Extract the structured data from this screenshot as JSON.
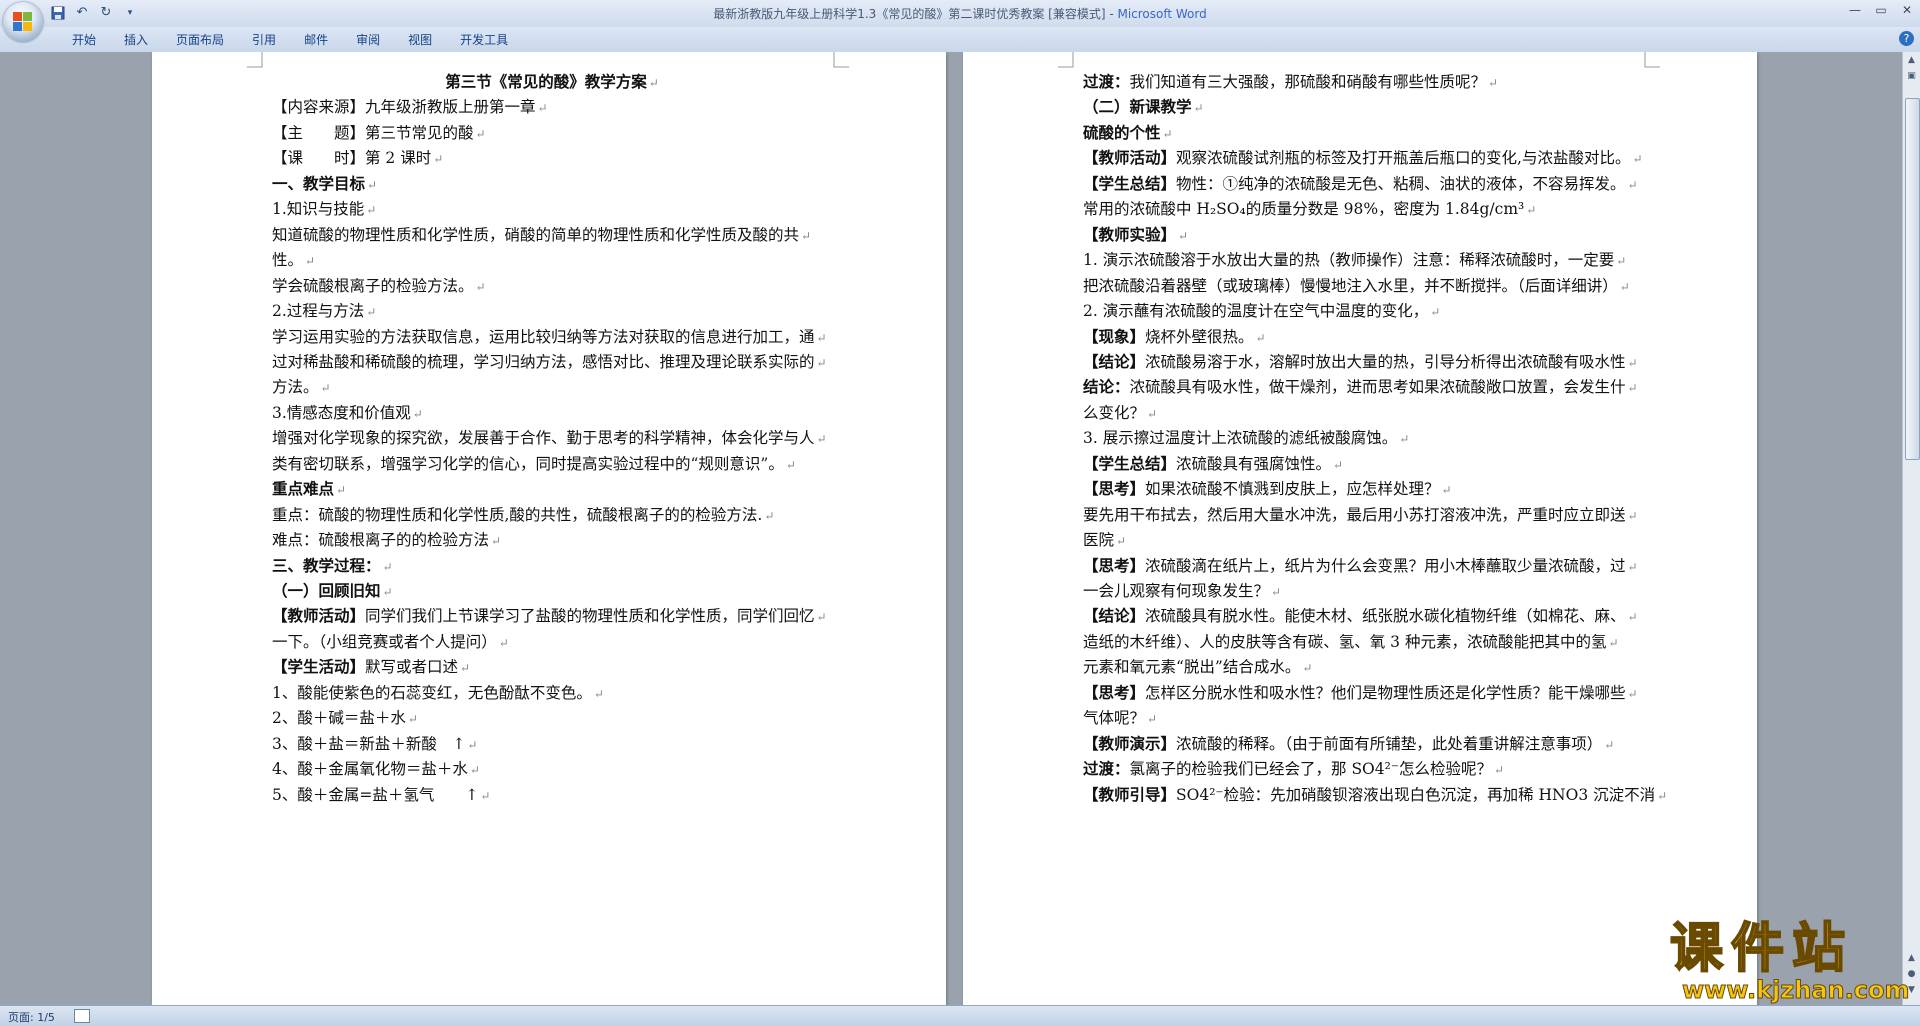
{
  "window": {
    "title_doc": "最新浙教版九年级上册科学1.3《常见的酸》第二课时优秀教案 [兼容模式] - ",
    "title_app": "Microsoft Word"
  },
  "ribbon": {
    "tabs": [
      "开始",
      "插入",
      "页面布局",
      "引用",
      "邮件",
      "审阅",
      "视图",
      "开发工具"
    ]
  },
  "status": {
    "page": "页面: 1/5"
  },
  "watermark": {
    "cn": "课件站",
    "url": "www.kjzhan.com"
  },
  "pages": [
    {
      "lines": [
        {
          "b": "第三节《常见的酸》教学方案",
          "t": "",
          "center": true
        },
        {
          "b": "",
          "t": "【内容来源】九年级浙教版上册第一章"
        },
        {
          "b": "",
          "t": "【主　　题】第三节常见的酸"
        },
        {
          "b": "",
          "t": "【课　　时】第 2 课时"
        },
        {
          "b": "一、教学目标",
          "t": ""
        },
        {
          "b": "",
          "t": "1.知识与技能"
        },
        {
          "b": "",
          "t": "知道硫酸的物理性质和化学性质，硝酸的简单的物理性质和化学性质及酸的共"
        },
        {
          "b": "",
          "t": "性。"
        },
        {
          "b": "",
          "t": "学会硫酸根离子的检验方法。"
        },
        {
          "b": "",
          "t": "2.过程与方法"
        },
        {
          "b": "",
          "t": "学习运用实验的方法获取信息，运用比较归纳等方法对获取的信息进行加工，通"
        },
        {
          "b": "",
          "t": "过对稀盐酸和稀硫酸的梳理，学习归纳方法，感悟对比、推理及理论联系实际的"
        },
        {
          "b": "",
          "t": "方法。"
        },
        {
          "b": "",
          "t": "3.情感态度和价值观"
        },
        {
          "b": "",
          "t": "增强对化学现象的探究欲，发展善于合作、勤于思考的科学精神，体会化学与人"
        },
        {
          "b": "",
          "t": "类有密切联系，增强学习化学的信心，同时提高实验过程中的“规则意识”。"
        },
        {
          "b": "重点难点",
          "t": ""
        },
        {
          "b": "",
          "t": "重点：硫酸的物理性质和化学性质,酸的共性，硫酸根离子的的检验方法."
        },
        {
          "b": "",
          "t": "难点：硫酸根离子的的检验方法"
        },
        {
          "b": "三、教学过程：",
          "t": ""
        },
        {
          "b": "（一）回顾旧知",
          "t": ""
        },
        {
          "b": "【教师活动】",
          "t": "同学们我们上节课学习了盐酸的物理性质和化学性质，同学们回忆"
        },
        {
          "b": "",
          "t": " 一下。（小组竞赛或者个人提问）"
        },
        {
          "b": "【学生活动】",
          "t": "默写或者口述"
        },
        {
          "b": "",
          "t": "1、酸能使紫色的石蕊变红，无色酚酞不变色。"
        },
        {
          "b": "",
          "t": "2、酸＋碱＝盐＋水"
        },
        {
          "b": "",
          "t": "3、酸＋盐＝新盐＋新酸　↑"
        },
        {
          "b": "",
          "t": "4、酸＋金属氧化物＝盐＋水"
        },
        {
          "b": "",
          "t": "5、酸＋金属=盐＋氢气　　↑"
        }
      ]
    },
    {
      "lines": [
        {
          "b": "过渡：",
          "t": "我们知道有三大强酸，那硫酸和硝酸有哪些性质呢？"
        },
        {
          "b": "（二）新课教学",
          "t": ""
        },
        {
          "b": "硫酸的个性",
          "t": ""
        },
        {
          "b": "【教师活动】",
          "t": "观察浓硫酸试剂瓶的标签及打开瓶盖后瓶口的变化,与浓盐酸对比。"
        },
        {
          "b": "【学生总结】",
          "t": "物性：①纯净的浓硫酸是无色、粘稠、油状的液体，不容易挥发。"
        },
        {
          "b": "",
          "t": "常用的浓硫酸中 H₂SO₄的质量分数是 98%，密度为 1.84g/cm³"
        },
        {
          "b": "【教师实验】",
          "t": ""
        },
        {
          "b": "",
          "t": "1. 演示浓硫酸溶于水放出大量的热（教师操作）注意：稀释浓硫酸时，一定要"
        },
        {
          "b": "",
          "t": "把浓硫酸沿着器壁（或玻璃棒）慢慢地注入水里，并不断搅拌。（后面详细讲）"
        },
        {
          "b": "",
          "t": "2. 演示蘸有浓硫酸的温度计在空气中温度的变化，"
        },
        {
          "b": "【现象】",
          "t": "烧杯外壁很热。"
        },
        {
          "b": "【结论】",
          "t": "浓硫酸易溶于水，溶解时放出大量的热，引导分析得出浓硫酸有吸水性"
        },
        {
          "b": "结论：",
          "t": "浓硫酸具有吸水性，做干燥剂，进而思考如果浓硫酸敞口放置，会发生什"
        },
        {
          "b": "",
          "t": "么变化？"
        },
        {
          "b": "",
          "t": "3. 展示擦过温度计上浓硫酸的滤纸被酸腐蚀。"
        },
        {
          "b": "【学生总结】",
          "t": "浓硫酸具有强腐蚀性。"
        },
        {
          "b": "【思考】",
          "t": "如果浓硫酸不慎溅到皮肤上，应怎样处理？"
        },
        {
          "b": "",
          "t": "要先用干布拭去，然后用大量水冲洗，最后用小苏打溶液冲洗，严重时应立即送"
        },
        {
          "b": "",
          "t": "医院"
        },
        {
          "b": "【思考】",
          "t": "浓硫酸滴在纸片上，纸片为什么会变黑？用小木棒蘸取少量浓硫酸，过"
        },
        {
          "b": "",
          "t": "一会儿观察有何现象发生？"
        },
        {
          "b": "【结论】",
          "t": "浓硫酸具有脱水性。能使木材、纸张脱水碳化植物纤维（如棉花、麻、"
        },
        {
          "b": "",
          "t": "造纸的木纤维）、人的皮肤等含有碳、氢、氧 3 种元素，浓硫酸能把其中的氢"
        },
        {
          "b": "",
          "t": "元素和氧元素“脱出”结合成水。"
        },
        {
          "b": "【思考】",
          "t": "怎样区分脱水性和吸水性？他们是物理性质还是化学性质？能干燥哪些"
        },
        {
          "b": "",
          "t": "气体呢？"
        },
        {
          "b": "【教师演示】",
          "t": "浓硫酸的稀释。（由于前面有所铺垫，此处着重讲解注意事项）"
        },
        {
          "b": "过渡：",
          "t": "氯离子的检验我们已经会了，那 SO4²⁻怎么检验呢？"
        },
        {
          "b": "【教师引导】",
          "t": "SO4²⁻检验：先加硝酸钡溶液出现白色沉淀，再加稀 HNO3 沉淀不消"
        }
      ]
    }
  ]
}
